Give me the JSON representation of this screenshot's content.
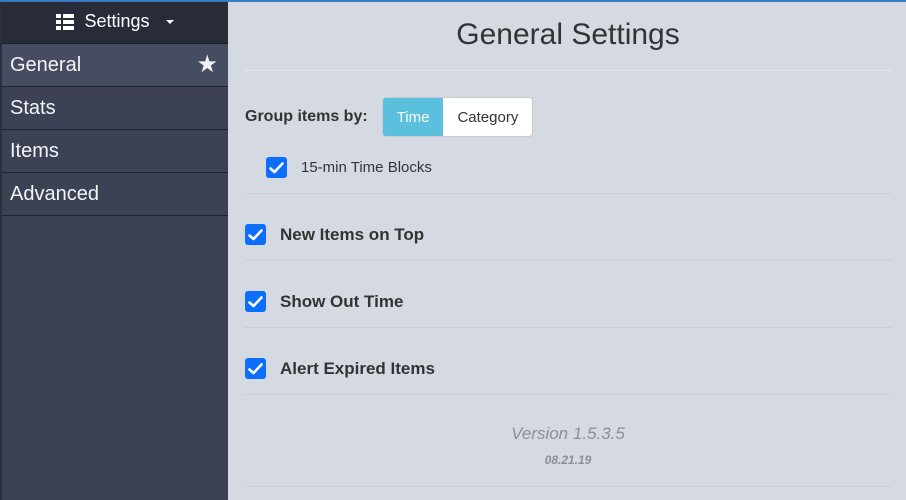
{
  "sidebar": {
    "header_label": "Settings",
    "items": [
      {
        "label": "General",
        "active": true
      },
      {
        "label": "Stats"
      },
      {
        "label": "Items"
      },
      {
        "label": "Advanced"
      }
    ]
  },
  "main": {
    "title": "General Settings",
    "group_label": "Group items by:",
    "group_options": [
      "Time",
      "Category"
    ],
    "group_selected": "Time",
    "time_blocks_label": "15-min Time Blocks",
    "settings": [
      {
        "label": "New Items on Top",
        "checked": true
      },
      {
        "label": "Show Out Time",
        "checked": true
      },
      {
        "label": "Alert Expired Items",
        "checked": true
      }
    ],
    "version": "Version 1.5.3.5",
    "date": "08.21.19"
  },
  "colors": {
    "accent": "#5bc0de",
    "checkbox": "#0d6efd",
    "sidebar_bg": "#3c4254",
    "sidebar_header_bg": "#272c38",
    "main_bg": "#d5d9e2"
  }
}
